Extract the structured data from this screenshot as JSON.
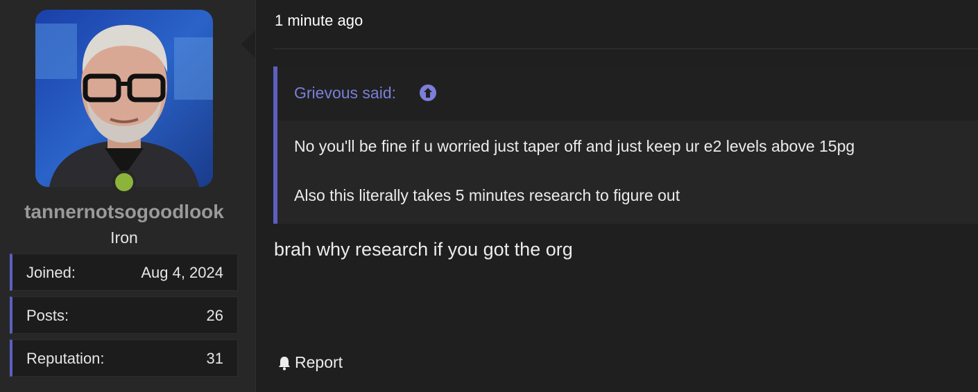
{
  "post": {
    "timestamp": "1 minute ago",
    "message": "brah why research if you got the org",
    "report_label": "Report"
  },
  "user": {
    "username": "tannernotsogoodlook",
    "rank": "Iron",
    "status": "online",
    "stats": [
      {
        "label": "Joined:",
        "value": "Aug 4, 2024"
      },
      {
        "label": "Posts:",
        "value": "26"
      },
      {
        "label": "Reputation:",
        "value": "31"
      }
    ]
  },
  "quote": {
    "author_label": "Grievous said:",
    "lines": [
      "No you'll be fine if u worried just taper off and just keep ur e2 levels above 15pg",
      "Also this literally takes 5 minutes research to figure out"
    ]
  },
  "colors": {
    "accent": "#5c5fbf",
    "quote_author": "#7b7fd8",
    "online": "#8cb43a",
    "username": "#9a9a9a"
  },
  "icons": {
    "quote_jump": "arrow-up-circle-icon",
    "report": "bell-icon"
  }
}
